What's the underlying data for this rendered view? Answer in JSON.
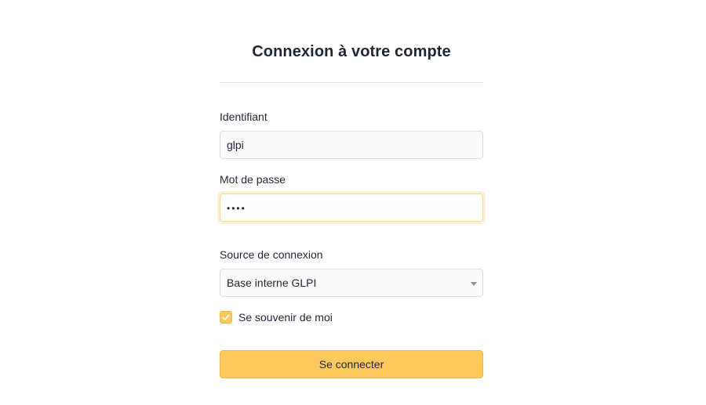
{
  "form": {
    "title": "Connexion à votre compte",
    "login_label": "Identifiant",
    "login_value": "glpi",
    "password_label": "Mot de passe",
    "password_value": "••••",
    "auth_source_label": "Source de connexion",
    "auth_source_selected": "Base interne GLPI",
    "remember_label": "Se souvenir de moi",
    "remember_checked": true,
    "submit_label": "Se connecter"
  },
  "icons": {
    "checkbox_check": "check-icon",
    "select_caret": "chevron-down-icon"
  },
  "colors": {
    "accent": "#fdc95c",
    "focus_ring": "#fbd88f",
    "text": "#1d2736"
  }
}
